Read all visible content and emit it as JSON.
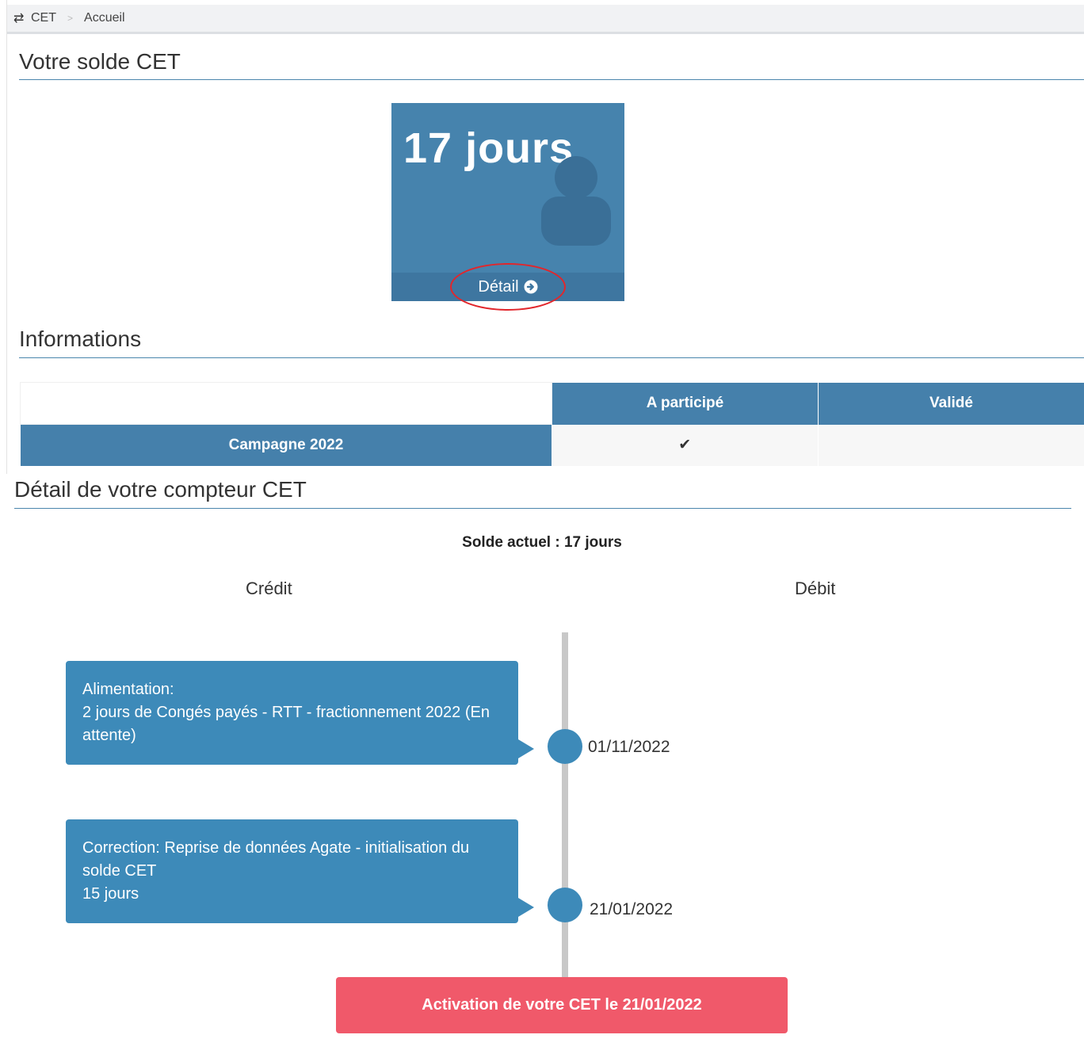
{
  "breadcrumb": {
    "root": "CET",
    "separator": ">",
    "current": "Accueil"
  },
  "solde_section": {
    "title": "Votre solde CET",
    "tile_value": "17 jours",
    "detail_label": "Détail"
  },
  "informations": {
    "title": "Informations",
    "columns": [
      "A participé",
      "Validé"
    ],
    "rows": [
      {
        "label": "Campagne 2022",
        "participated": "✔",
        "validated": ""
      }
    ]
  },
  "detail_section": {
    "title": "Détail de votre compteur CET",
    "solde_actuel": "Solde actuel : 17 jours",
    "credit_label": "Crédit",
    "debit_label": "Débit",
    "events": [
      {
        "line1": "Alimentation:",
        "line2": "2 jours de Congés payés - RTT - fractionnement 2022 (En attente)",
        "date": "01/11/2022"
      },
      {
        "line1": "Correction: Reprise de données Agate - initialisation du solde CET",
        "line2": "15 jours",
        "date": "21/01/2022"
      }
    ],
    "activation": "Activation de votre CET le 21/01/2022"
  },
  "colors": {
    "primary": "#4683ad",
    "timeline": "#3d8ab9",
    "danger": "#f0596a",
    "highlight": "#e2262b"
  }
}
